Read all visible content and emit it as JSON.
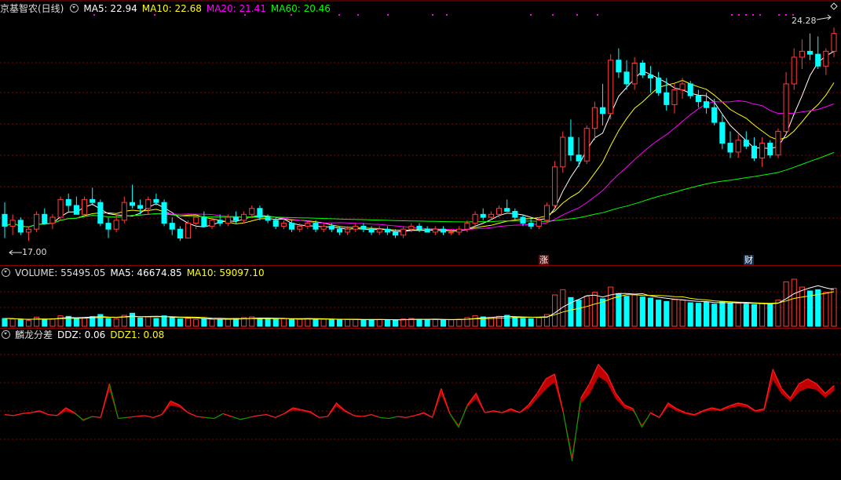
{
  "main_panel": {
    "stock_name": "京基智农(日线)",
    "ma_labels": [
      {
        "text": "MA5: 22.94",
        "color": "#ffffff"
      },
      {
        "text": "MA10: 22.68",
        "color": "#ffff00"
      },
      {
        "text": "MA20: 21.41",
        "color": "#ff00ff"
      },
      {
        "text": "MA60: 20.46",
        "color": "#00ff00"
      }
    ],
    "high_label": "24.28",
    "low_label": "17.00",
    "zhang_marker": "涨",
    "cai_marker": "财"
  },
  "volume_panel": {
    "title": "VOLUME: 55495.05",
    "ma5": "MA5: 46674.85",
    "ma10": "MA10: 59097.10"
  },
  "indicator_panel": {
    "title": "麟龙分差",
    "ddz": "DDZ: 0.06",
    "ddz1": "DDZ1: 0.08"
  },
  "colors": {
    "up": "#ff3c3c",
    "down": "#00ffff",
    "ma5": "#ffffff",
    "ma10": "#ffff00",
    "ma20": "#ff00ff",
    "ma60": "#00ff00",
    "grid": "#8b0000"
  },
  "chart_data": {
    "type": "candlestick",
    "y_range": [
      16.5,
      24.7
    ],
    "candles": [
      [
        18.0,
        18.4,
        17.2,
        17.6
      ],
      [
        17.6,
        18.0,
        17.3,
        17.8
      ],
      [
        17.8,
        17.9,
        17.3,
        17.4
      ],
      [
        17.4,
        17.6,
        17.1,
        17.5
      ],
      [
        17.5,
        18.1,
        17.4,
        18.0
      ],
      [
        18.0,
        18.2,
        17.7,
        17.7
      ],
      [
        17.7,
        18.0,
        17.5,
        17.9
      ],
      [
        17.9,
        18.6,
        17.8,
        18.5
      ],
      [
        18.5,
        18.7,
        18.1,
        18.3
      ],
      [
        18.3,
        18.6,
        18.0,
        18.0
      ],
      [
        18.0,
        18.6,
        17.9,
        18.5
      ],
      [
        18.5,
        18.9,
        18.3,
        18.4
      ],
      [
        18.4,
        18.5,
        17.6,
        17.7
      ],
      [
        17.7,
        17.9,
        17.2,
        17.5
      ],
      [
        17.5,
        18.0,
        17.4,
        17.8
      ],
      [
        17.8,
        18.6,
        17.7,
        18.4
      ],
      [
        18.4,
        19.0,
        18.2,
        18.3
      ],
      [
        18.3,
        18.5,
        18.0,
        18.2
      ],
      [
        18.2,
        18.6,
        18.0,
        18.5
      ],
      [
        18.5,
        18.7,
        18.3,
        18.4
      ],
      [
        18.4,
        18.5,
        17.6,
        17.7
      ],
      [
        17.7,
        17.9,
        17.3,
        17.5
      ],
      [
        17.5,
        17.6,
        17.1,
        17.2
      ],
      [
        17.2,
        17.8,
        17.2,
        17.7
      ],
      [
        17.7,
        17.9,
        17.5,
        17.9
      ],
      [
        17.9,
        18.1,
        17.6,
        17.6
      ],
      [
        17.6,
        17.9,
        17.5,
        17.8
      ],
      [
        17.8,
        18.0,
        17.6,
        17.7
      ],
      [
        17.7,
        18.0,
        17.6,
        17.9
      ],
      [
        17.9,
        18.1,
        17.7,
        17.8
      ],
      [
        17.8,
        18.1,
        17.7,
        18.0
      ],
      [
        18.0,
        18.3,
        17.9,
        18.2
      ],
      [
        18.2,
        18.3,
        17.8,
        17.9
      ],
      [
        17.9,
        18.0,
        17.7,
        17.8
      ],
      [
        17.8,
        17.9,
        17.5,
        17.6
      ],
      [
        17.6,
        17.8,
        17.5,
        17.7
      ],
      [
        17.7,
        17.8,
        17.4,
        17.5
      ],
      [
        17.5,
        17.7,
        17.4,
        17.6
      ],
      [
        17.6,
        17.8,
        17.5,
        17.7
      ],
      [
        17.7,
        17.8,
        17.4,
        17.5
      ],
      [
        17.5,
        17.7,
        17.4,
        17.6
      ],
      [
        17.6,
        17.7,
        17.4,
        17.5
      ],
      [
        17.5,
        17.6,
        17.3,
        17.4
      ],
      [
        17.4,
        17.6,
        17.3,
        17.5
      ],
      [
        17.5,
        17.7,
        17.4,
        17.6
      ],
      [
        17.6,
        17.7,
        17.4,
        17.5
      ],
      [
        17.5,
        17.6,
        17.3,
        17.4
      ],
      [
        17.4,
        17.6,
        17.3,
        17.5
      ],
      [
        17.5,
        17.6,
        17.3,
        17.4
      ],
      [
        17.4,
        17.5,
        17.2,
        17.3
      ],
      [
        17.3,
        17.6,
        17.2,
        17.5
      ],
      [
        17.5,
        17.7,
        17.4,
        17.6
      ],
      [
        17.6,
        17.7,
        17.4,
        17.5
      ],
      [
        17.5,
        17.6,
        17.4,
        17.4
      ],
      [
        17.4,
        17.6,
        17.3,
        17.5
      ],
      [
        17.5,
        17.6,
        17.3,
        17.4
      ],
      [
        17.4,
        17.5,
        17.3,
        17.4
      ],
      [
        17.4,
        17.6,
        17.3,
        17.5
      ],
      [
        17.5,
        17.8,
        17.4,
        17.7
      ],
      [
        17.7,
        18.1,
        17.6,
        18.0
      ],
      [
        18.0,
        18.2,
        17.8,
        17.9
      ],
      [
        17.9,
        18.1,
        17.8,
        18.0
      ],
      [
        18.0,
        18.3,
        17.9,
        18.2
      ],
      [
        18.2,
        18.5,
        18.1,
        18.1
      ],
      [
        18.1,
        18.2,
        17.8,
        17.9
      ],
      [
        17.9,
        18.0,
        17.6,
        17.7
      ],
      [
        17.7,
        17.9,
        17.5,
        17.6
      ],
      [
        17.6,
        17.9,
        17.5,
        17.8
      ],
      [
        17.8,
        18.4,
        17.7,
        18.3
      ],
      [
        18.3,
        19.8,
        18.2,
        19.6
      ],
      [
        19.6,
        20.8,
        19.4,
        20.6
      ],
      [
        20.6,
        21.2,
        19.8,
        20.0
      ],
      [
        20.0,
        20.6,
        19.6,
        19.8
      ],
      [
        19.8,
        21.0,
        19.7,
        20.9
      ],
      [
        20.9,
        21.8,
        20.5,
        21.6
      ],
      [
        21.6,
        22.4,
        21.0,
        21.4
      ],
      [
        21.4,
        23.4,
        21.2,
        23.2
      ],
      [
        23.2,
        23.6,
        22.6,
        22.8
      ],
      [
        22.8,
        23.2,
        22.2,
        22.4
      ],
      [
        22.4,
        23.3,
        22.2,
        23.1
      ],
      [
        23.1,
        23.2,
        22.6,
        22.7
      ],
      [
        22.7,
        23.0,
        22.1,
        22.6
      ],
      [
        22.6,
        22.8,
        22.0,
        22.1
      ],
      [
        22.1,
        22.6,
        21.5,
        21.7
      ],
      [
        21.7,
        22.4,
        21.4,
        22.2
      ],
      [
        22.2,
        22.6,
        21.9,
        22.4
      ],
      [
        22.4,
        22.5,
        21.9,
        22.0
      ],
      [
        22.0,
        22.2,
        21.6,
        21.8
      ],
      [
        21.8,
        22.1,
        21.4,
        21.6
      ],
      [
        21.6,
        21.9,
        21.0,
        21.1
      ],
      [
        21.1,
        21.4,
        20.2,
        20.4
      ],
      [
        20.4,
        20.8,
        19.9,
        20.1
      ],
      [
        20.1,
        20.7,
        19.9,
        20.5
      ],
      [
        20.5,
        20.8,
        20.2,
        20.3
      ],
      [
        20.3,
        20.6,
        19.8,
        19.9
      ],
      [
        19.9,
        20.6,
        19.6,
        20.4
      ],
      [
        20.4,
        20.5,
        19.9,
        20.0
      ],
      [
        20.0,
        20.9,
        19.9,
        20.8
      ],
      [
        20.8,
        22.8,
        20.7,
        22.4
      ],
      [
        22.4,
        23.6,
        22.2,
        23.3
      ],
      [
        23.3,
        23.9,
        22.9,
        23.5
      ],
      [
        23.5,
        24.1,
        23.2,
        23.4
      ],
      [
        23.4,
        24.0,
        22.9,
        23.0
      ],
      [
        23.0,
        23.6,
        22.7,
        23.5
      ],
      [
        23.5,
        24.3,
        23.3,
        24.1
      ]
    ],
    "volume": [
      30,
      28,
      25,
      22,
      35,
      27,
      29,
      40,
      38,
      30,
      33,
      37,
      45,
      30,
      28,
      42,
      50,
      32,
      36,
      30,
      40,
      35,
      28,
      30,
      26,
      29,
      27,
      25,
      28,
      30,
      33,
      36,
      31,
      28,
      27,
      29,
      26,
      27,
      30,
      28,
      27,
      25,
      24,
      26,
      27,
      25,
      24,
      26,
      25,
      23,
      28,
      30,
      27,
      25,
      26,
      24,
      25,
      27,
      33,
      40,
      36,
      34,
      38,
      42,
      35,
      30,
      29,
      33,
      45,
      120,
      140,
      110,
      100,
      115,
      130,
      105,
      150,
      125,
      115,
      120,
      112,
      108,
      100,
      95,
      102,
      100,
      90,
      88,
      92,
      85,
      95,
      90,
      88,
      85,
      83,
      88,
      85,
      100,
      170,
      180,
      150,
      135,
      140,
      130,
      145
    ],
    "ddz": [
      0.08,
      0.07,
      0.09,
      0.1,
      0.12,
      0.08,
      0.07,
      0.15,
      0.1,
      0.02,
      0.06,
      0.05,
      0.4,
      0.04,
      0.05,
      0.06,
      0.07,
      0.05,
      0.08,
      0.22,
      0.18,
      0.1,
      0.06,
      0.05,
      0.04,
      0.09,
      0.06,
      0.03,
      0.05,
      0.07,
      0.08,
      0.05,
      0.09,
      0.15,
      0.13,
      0.11,
      0.05,
      0.06,
      0.2,
      0.12,
      0.07,
      0.06,
      0.08,
      0.05,
      0.04,
      0.06,
      0.05,
      0.07,
      0.1,
      0.05,
      0.35,
      0.09,
      -0.05,
      0.18,
      0.3,
      0.1,
      0.12,
      0.1,
      0.14,
      0.1,
      0.18,
      0.3,
      0.45,
      0.5,
      0.1,
      -0.4,
      0.25,
      0.4,
      0.6,
      0.5,
      0.3,
      0.18,
      0.14,
      -0.05,
      0.1,
      0.05,
      0.2,
      0.14,
      0.1,
      0.08,
      0.12,
      0.15,
      0.13,
      0.17,
      0.2,
      0.18,
      0.12,
      0.14,
      0.55,
      0.35,
      0.25,
      0.4,
      0.45,
      0.4,
      0.3,
      0.38
    ],
    "ddz1": [
      0.08,
      0.07,
      0.09,
      0.1,
      0.11,
      0.08,
      0.07,
      0.12,
      0.09,
      0.03,
      0.06,
      0.05,
      0.35,
      0.04,
      0.05,
      0.06,
      0.07,
      0.05,
      0.08,
      0.18,
      0.16,
      0.1,
      0.06,
      0.05,
      0.04,
      0.09,
      0.06,
      0.03,
      0.05,
      0.07,
      0.08,
      0.05,
      0.09,
      0.13,
      0.12,
      0.1,
      0.05,
      0.06,
      0.17,
      0.11,
      0.07,
      0.06,
      0.08,
      0.05,
      0.04,
      0.06,
      0.05,
      0.07,
      0.09,
      0.05,
      0.3,
      0.09,
      -0.03,
      0.16,
      0.25,
      0.1,
      0.11,
      0.1,
      0.12,
      0.1,
      0.15,
      0.25,
      0.35,
      0.42,
      0.1,
      -0.35,
      0.2,
      0.3,
      0.48,
      0.42,
      0.25,
      0.15,
      0.12,
      -0.03,
      0.09,
      0.05,
      0.17,
      0.12,
      0.09,
      0.07,
      0.11,
      0.13,
      0.12,
      0.15,
      0.17,
      0.16,
      0.11,
      0.12,
      0.45,
      0.3,
      0.22,
      0.32,
      0.36,
      0.34,
      0.26,
      0.33
    ]
  }
}
